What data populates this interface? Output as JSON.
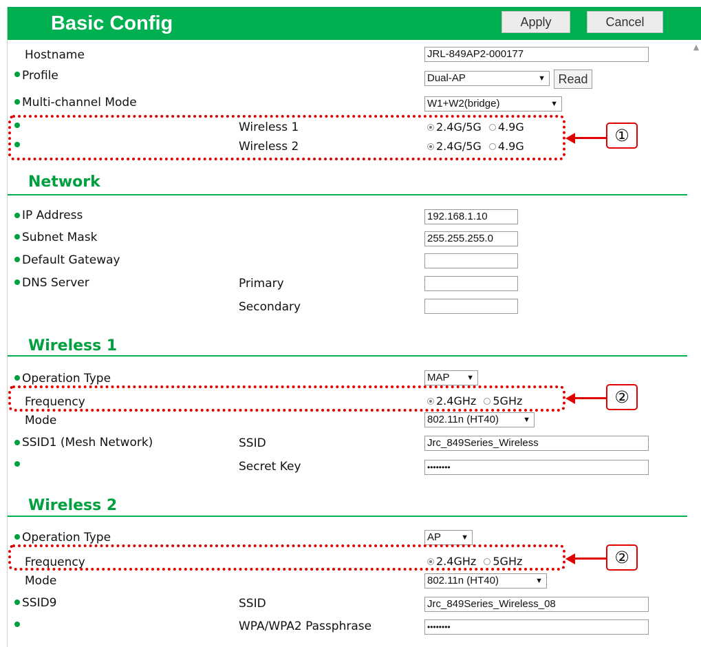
{
  "header": {
    "title": "Basic Config",
    "apply_label": "Apply",
    "cancel_label": "Cancel"
  },
  "basic": {
    "hostname": {
      "label": "Hostname",
      "value": "JRL-849AP2-000177"
    },
    "profile": {
      "label": "Profile",
      "value": "Dual-AP",
      "read_label": "Read"
    },
    "multichannel": {
      "label": "Multi-channel Mode",
      "value": "W1+W2(bridge)"
    },
    "wireless1_band": {
      "label": "Wireless 1",
      "opt1": "2.4G/5G",
      "opt2": "4.9G",
      "selected": "2.4G/5G"
    },
    "wireless2_band": {
      "label": "Wireless 2",
      "opt1": "2.4G/5G",
      "opt2": "4.9G",
      "selected": "2.4G/5G"
    },
    "callout": "①"
  },
  "network": {
    "title": "Network",
    "ip": {
      "label": "IP Address",
      "value": "192.168.1.10"
    },
    "subnet": {
      "label": "Subnet Mask",
      "value": "255.255.255.0"
    },
    "gateway": {
      "label": "Default Gateway",
      "value": ""
    },
    "dns": {
      "label": "DNS Server",
      "primary_label": "Primary",
      "primary_value": "",
      "secondary_label": "Secondary",
      "secondary_value": ""
    }
  },
  "wireless1": {
    "title": "Wireless 1",
    "operation_type": {
      "label": "Operation Type",
      "value": "MAP"
    },
    "frequency": {
      "label": "Frequency",
      "opt1": "2.4GHz",
      "opt2": "5GHz",
      "selected": "2.4GHz"
    },
    "mode": {
      "label": "Mode",
      "value": "802.11n (HT40)"
    },
    "ssid": {
      "label": "SSID1 (Mesh Network)",
      "ssid_label": "SSID",
      "ssid_value": "Jrc_849Series_Wireless"
    },
    "secret": {
      "label": "Secret Key",
      "value": "••••••••"
    },
    "callout": "②"
  },
  "wireless2": {
    "title": "Wireless 2",
    "operation_type": {
      "label": "Operation Type",
      "value": "AP"
    },
    "frequency": {
      "label": "Frequency",
      "opt1": "2.4GHz",
      "opt2": "5GHz",
      "selected": "2.4GHz"
    },
    "mode": {
      "label": "Mode",
      "value": "802.11n (HT40)"
    },
    "ssid": {
      "label": "SSID9",
      "ssid_label": "SSID",
      "ssid_value": "Jrc_849Series_Wireless_08"
    },
    "passphrase": {
      "label": "WPA/WPA2 Passphrase",
      "value": "••••••••"
    },
    "callout": "②"
  },
  "colors": {
    "accent": "#00b050",
    "annotation": "#e00000"
  },
  "icons": {
    "select_arrow": "▼",
    "status_dot": "green-dot-icon",
    "scroll_up": "▲"
  }
}
